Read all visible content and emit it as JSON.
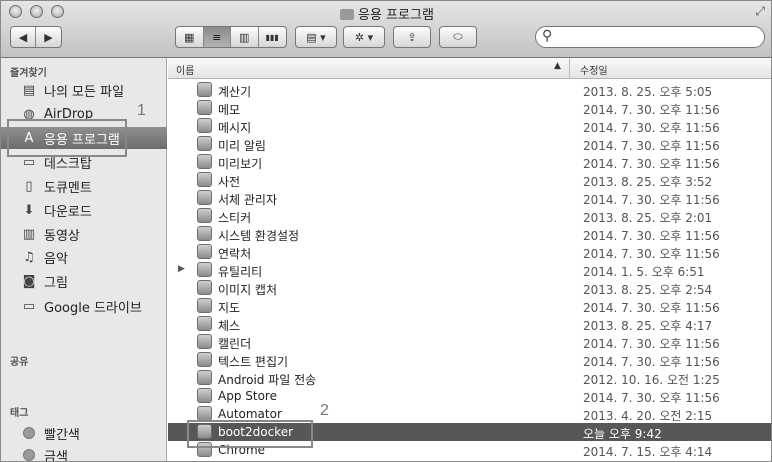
{
  "window": {
    "title": "응용 프로그램"
  },
  "toolbar": {
    "back_icon": "◀",
    "forward_icon": "▶",
    "view_icons": [
      "▦",
      "≡",
      "▥",
      "▮▮▮"
    ],
    "arrange_icon": "▤ ▾",
    "action_icon": "✲ ▾",
    "share_icon": "⇪",
    "tag_icon": "⬭"
  },
  "search": {
    "placeholder": ""
  },
  "sidebar": {
    "favorites_heading": "즐겨찾기",
    "favorites": [
      {
        "label": "나의 모든 파일",
        "icon": "▤"
      },
      {
        "label": "AirDrop",
        "icon": "◍"
      },
      {
        "label": "응용 프로그램",
        "icon": "A"
      },
      {
        "label": "데스크탑",
        "icon": "▭"
      },
      {
        "label": "도큐멘트",
        "icon": "▯"
      },
      {
        "label": "다운로드",
        "icon": "⬇"
      },
      {
        "label": "동영상",
        "icon": "▥"
      },
      {
        "label": "음악",
        "icon": "♫"
      },
      {
        "label": "그림",
        "icon": "◙"
      },
      {
        "label": "Google 드라이브",
        "icon": "▭"
      }
    ],
    "shared_heading": "공유",
    "tags_heading": "태그",
    "tags": [
      {
        "label": "빨간색"
      },
      {
        "label": "금색"
      }
    ]
  },
  "list": {
    "col_name": "이름",
    "col_date": "수정일",
    "sort_arrow": "▲",
    "disclosure": "▶",
    "rows": [
      {
        "name": "계산기",
        "date": "2013. 8. 25. 오후 5:05"
      },
      {
        "name": "메모",
        "date": "2014. 7. 30. 오후 11:56"
      },
      {
        "name": "메시지",
        "date": "2014. 7. 30. 오후 11:56"
      },
      {
        "name": "미리 알림",
        "date": "2014. 7. 30. 오후 11:56"
      },
      {
        "name": "미리보기",
        "date": "2014. 7. 30. 오후 11:56"
      },
      {
        "name": "사전",
        "date": "2013. 8. 25. 오후 3:52"
      },
      {
        "name": "서체 관리자",
        "date": "2014. 7. 30. 오후 11:56"
      },
      {
        "name": "스티커",
        "date": "2013. 8. 25. 오후 2:01"
      },
      {
        "name": "시스템 환경설정",
        "date": "2014. 7. 30. 오후 11:56"
      },
      {
        "name": "연락처",
        "date": "2014. 7. 30. 오후 11:56"
      },
      {
        "name": "유틸리티",
        "date": "2014. 1. 5. 오후 6:51"
      },
      {
        "name": "이미지 캡처",
        "date": "2013. 8. 25. 오후 2:54"
      },
      {
        "name": "지도",
        "date": "2014. 7. 30. 오후 11:56"
      },
      {
        "name": "체스",
        "date": "2013. 8. 25. 오후 4:17"
      },
      {
        "name": "캘린더",
        "date": "2014. 7. 30. 오후 11:56"
      },
      {
        "name": "텍스트 편집기",
        "date": "2014. 7. 30. 오후 11:56"
      },
      {
        "name": "Android 파일 전송",
        "date": "2012. 10. 16. 오전 1:25"
      },
      {
        "name": "App Store",
        "date": "2014. 7. 30. 오후 11:56"
      },
      {
        "name": "Automator",
        "date": "2013. 4. 20. 오전 2:15"
      },
      {
        "name": "boot2docker",
        "date": "오늘 오후 9:42"
      },
      {
        "name": "Chrome",
        "date": "2014. 7. 15. 오후 4:14"
      }
    ]
  },
  "annotations": {
    "label_1": "1",
    "label_2": "2"
  }
}
